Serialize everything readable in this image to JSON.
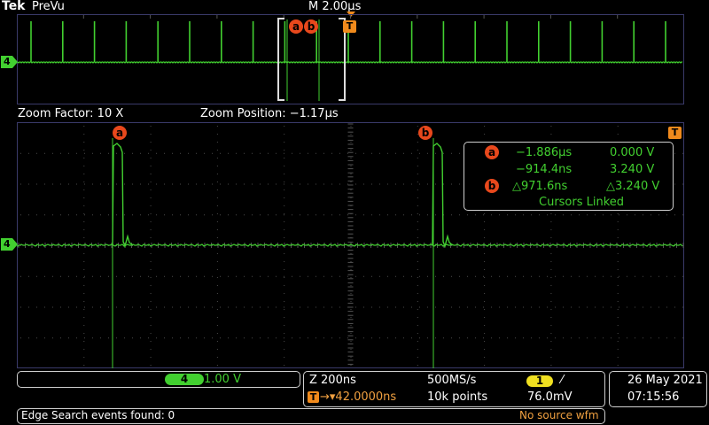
{
  "header": {
    "brand": "Tek",
    "mode": "PreVu",
    "horizontal_scale": "M 2.00µs"
  },
  "overview": {
    "channel_label": "4",
    "cursor_a": "a",
    "cursor_b": "b",
    "trigger_label": "T"
  },
  "zoom": {
    "factor_label": "Zoom Factor: 10 X",
    "position_label": "Zoom Position: −1.17µs",
    "channel_label": "4",
    "cursor_a": "a",
    "cursor_b": "b",
    "trigger_label": "T"
  },
  "cursor_readout": {
    "a_label": "a",
    "b_label": "b",
    "a_time": "−1.886µs",
    "a_volt": "0.000 V",
    "b_time": "−914.4ns",
    "b_volt": "3.240 V",
    "delta_time": "△971.6ns",
    "delta_volt": "△3.240 V",
    "linked": "Cursors Linked"
  },
  "channel_box": {
    "channel": "4",
    "scale": "1.00 V"
  },
  "timebase": {
    "zoom_scale": "Z 200ns",
    "sample_rate": "500MS/s",
    "trigger_source": "1",
    "trigger_slope": "⁄",
    "trigger_icon": "T",
    "trigger_delay": "→▾42.0000ns",
    "record_length": "10k points",
    "trigger_level": "76.0mV"
  },
  "datetime": {
    "date": "26 May 2021",
    "time": "07:15:56"
  },
  "status": {
    "message": "Edge Search events found: 0",
    "warning": "No source wfm"
  },
  "colors": {
    "channel4": "#42d030",
    "cursor": "#e8481c",
    "trigger": "#f08a1c",
    "channel1": "#f0e020"
  }
}
